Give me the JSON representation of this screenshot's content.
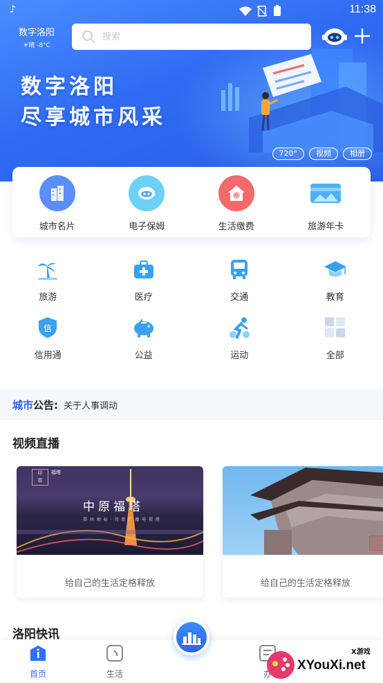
{
  "status": {
    "time": "11:38"
  },
  "header": {
    "city_name": "数字洛阳",
    "weather": "☀晴 -8°C",
    "search_placeholder": "搜索"
  },
  "banner": {
    "slogan_line1": "数字洛阳",
    "slogan_line2": "尽享城市风采",
    "tags": [
      "720°",
      "视频",
      "相册"
    ]
  },
  "quick_services": [
    {
      "label": "城市名片",
      "icon": "building-icon",
      "color": "#5b8ef7"
    },
    {
      "label": "电子保姆",
      "icon": "robot-icon",
      "color": "#6fd0f5"
    },
    {
      "label": "生活缴费",
      "icon": "house-yuan-icon",
      "color": "#f26a6a"
    },
    {
      "label": "旅游年卡",
      "icon": "card-icon",
      "color": "#4fb1f5"
    }
  ],
  "services": [
    {
      "label": "旅游",
      "icon": "palm-tree-icon"
    },
    {
      "label": "医疗",
      "icon": "medical-kit-icon"
    },
    {
      "label": "交通",
      "icon": "bus-icon"
    },
    {
      "label": "教育",
      "icon": "graduation-cap-icon"
    },
    {
      "label": "信用通",
      "icon": "credit-shield-icon"
    },
    {
      "label": "公益",
      "icon": "piggy-bank-icon"
    },
    {
      "label": "运动",
      "icon": "runner-icon"
    },
    {
      "label": "全部",
      "icon": "grid-icon"
    }
  ],
  "notice": {
    "title_a": "城市",
    "title_b": "公告:",
    "text": "关于人事调动"
  },
  "video_section": {
    "title": "视频直播",
    "cards": [
      {
        "caption": "给自己的生活定格释放",
        "sign": "中原福塔"
      },
      {
        "caption": "给自己的生活定格释放"
      }
    ]
  },
  "news_section": {
    "title": "洛阳快讯"
  },
  "tabbar": {
    "tabs": [
      {
        "label": "首页",
        "icon": "home-info-icon",
        "active": true
      },
      {
        "label": "生活",
        "icon": "life-icon",
        "active": false
      },
      {
        "label": "办",
        "icon": "affairs-icon",
        "active": false
      }
    ]
  },
  "watermark": {
    "text": "XYouXi.net",
    "sub": "X游戏"
  },
  "colors": {
    "primary": "#2e6fff",
    "banner": "#3170f0",
    "notice_accent": "#2e64e6"
  }
}
